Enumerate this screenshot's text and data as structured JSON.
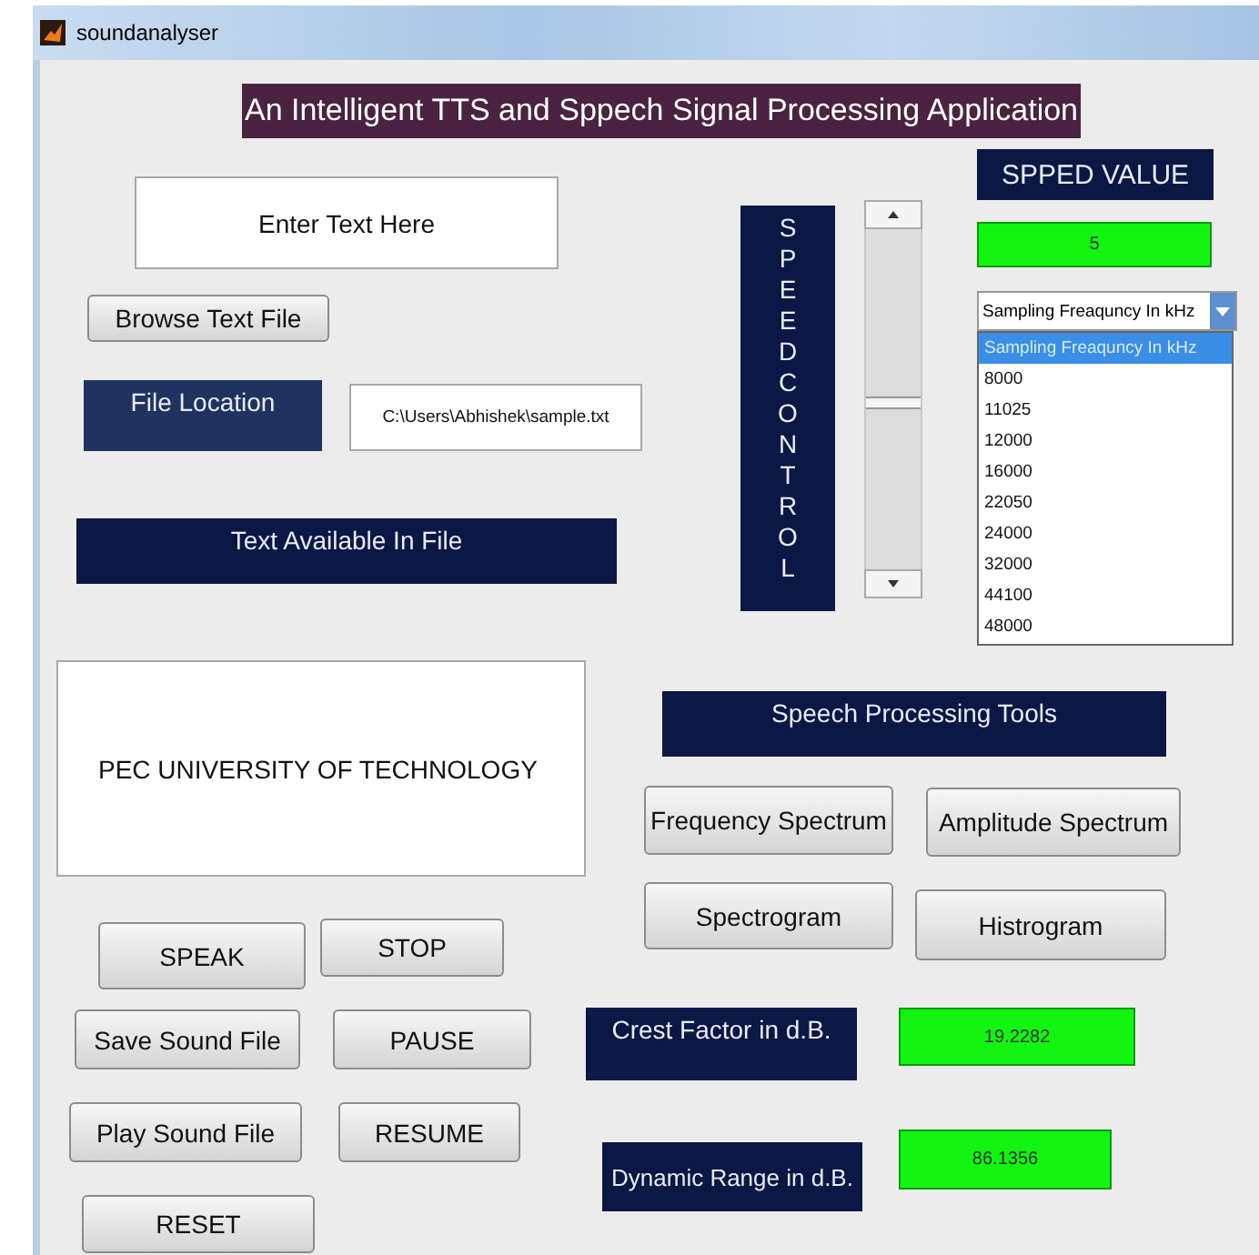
{
  "window": {
    "title": "soundanalyser"
  },
  "banner": "An Intelligent TTS and Sppech Signal Processing Application",
  "text_input": {
    "value": "Enter Text Here"
  },
  "browse_button": "Browse Text File",
  "file_location": {
    "label": "File Location",
    "value": "C:\\Users\\Abhishek\\sample.txt"
  },
  "text_available_label": "Text Available In File",
  "speed_control": {
    "label": "SPEEDCONTROL",
    "level": 0.5
  },
  "speed_value": {
    "label": "SPPED VALUE",
    "value": "5"
  },
  "sampling_dropdown": {
    "value": "Sampling Freaquncy In kHz",
    "expanded": true,
    "options": [
      {
        "label": "Sampling Freaquncy In kHz",
        "selected": true
      },
      {
        "label": "8000",
        "selected": false
      },
      {
        "label": "11025",
        "selected": false
      },
      {
        "label": "12000",
        "selected": false
      },
      {
        "label": "16000",
        "selected": false
      },
      {
        "label": "22050",
        "selected": false
      },
      {
        "label": "24000",
        "selected": false
      },
      {
        "label": "32000",
        "selected": false
      },
      {
        "label": "44100",
        "selected": false
      },
      {
        "label": "48000",
        "selected": false
      }
    ]
  },
  "display_text": "PEC UNIVERSITY OF TECHNOLOGY",
  "tools": {
    "label": "Speech Processing Tools",
    "buttons": [
      "Frequency Spectrum",
      "Amplitude Spectrum",
      "Spectrogram",
      "Histrogram"
    ]
  },
  "playback_buttons": [
    "SPEAK",
    "STOP",
    "Save Sound File",
    "PAUSE",
    "Play Sound File",
    "RESUME",
    "RESET"
  ],
  "crest_factor": {
    "label": "Crest Factor in d.B.",
    "value": "19.2282"
  },
  "dynamic_range": {
    "label": "Dynamic Range in d.B.",
    "value": "86.1356"
  }
}
